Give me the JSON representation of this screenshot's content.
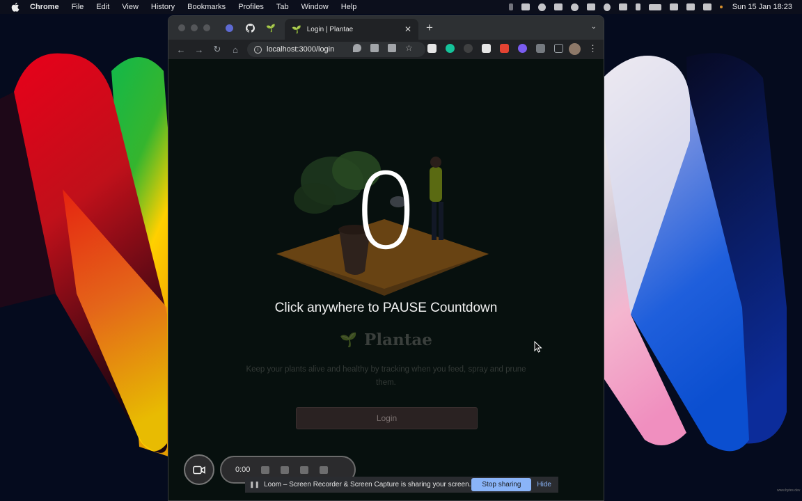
{
  "menubar": {
    "app": "Chrome",
    "items": [
      "File",
      "Edit",
      "View",
      "History",
      "Bookmarks",
      "Profiles",
      "Tab",
      "Window",
      "Help"
    ],
    "clock": "Sun 15 Jan  18:23"
  },
  "browser": {
    "tab_title": "Login | Plantae",
    "url": "localhost:3000/login"
  },
  "page": {
    "countdown": "0",
    "pause_message": "Click anywhere to PAUSE Countdown",
    "brand": "Plantae",
    "tagline": "Keep your plants alive and healthy by tracking when you feed, spray and prune them.",
    "login_label": "Login"
  },
  "loom": {
    "timer": "0:00",
    "share_message": "Loom – Screen Recorder & Screen Capture is sharing your screen.",
    "stop_label": "Stop sharing",
    "hide_label": "Hide"
  },
  "watermark": "www.bytes.dev",
  "colors": {
    "accent": "#8ab4f8",
    "page_bg": "#07100e",
    "brand_text": "#3a3f3c"
  }
}
